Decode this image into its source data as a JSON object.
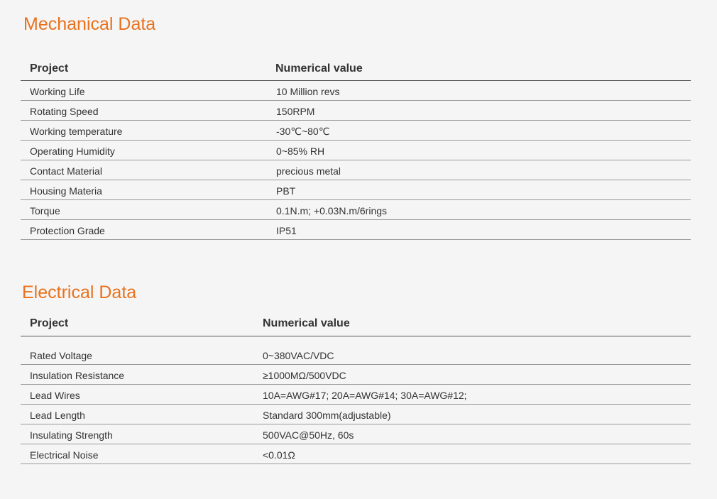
{
  "mechanical": {
    "title": "Mechanical Data",
    "header": {
      "project": "Project",
      "value": "Numerical value"
    },
    "rows": [
      {
        "project": "Working Life",
        "value": "10 Million revs"
      },
      {
        "project": "Rotating Speed",
        "value": "150RPM"
      },
      {
        "project": "Working temperature",
        "value": "-30℃~80℃"
      },
      {
        "project": "Operating Humidity",
        "value": "0~85% RH"
      },
      {
        "project": "Contact Material",
        "value": "precious metal"
      },
      {
        "project": "Housing Materia",
        "value": "PBT"
      },
      {
        "project": "Torque",
        "value": "0.1N.m;  +0.03N.m/6rings"
      },
      {
        "project": "Protection Grade",
        "value": "IP51"
      }
    ]
  },
  "electrical": {
    "title": "Electrical Data",
    "header": {
      "project": "Project",
      "value": "Numerical value"
    },
    "rows": [
      {
        "project": "Rated Voltage",
        "value": "0~380VAC/VDC"
      },
      {
        "project": "Insulation Resistance",
        "value": "≥1000MΩ/500VDC"
      },
      {
        "project": "Lead Wires",
        "value": "10A=AWG#17; 20A=AWG#14; 30A=AWG#12;"
      },
      {
        "project": "Lead Length",
        "value": "Standard 300mm(adjustable)"
      },
      {
        "project": "Insulating Strength",
        "value": "500VAC@50Hz, 60s"
      },
      {
        "project": "Electrical Noise",
        "value": "<0.01Ω"
      }
    ]
  },
  "colors": {
    "title_accent": "#e8721e",
    "text": "#333333",
    "rule": "#9a9a9a"
  }
}
